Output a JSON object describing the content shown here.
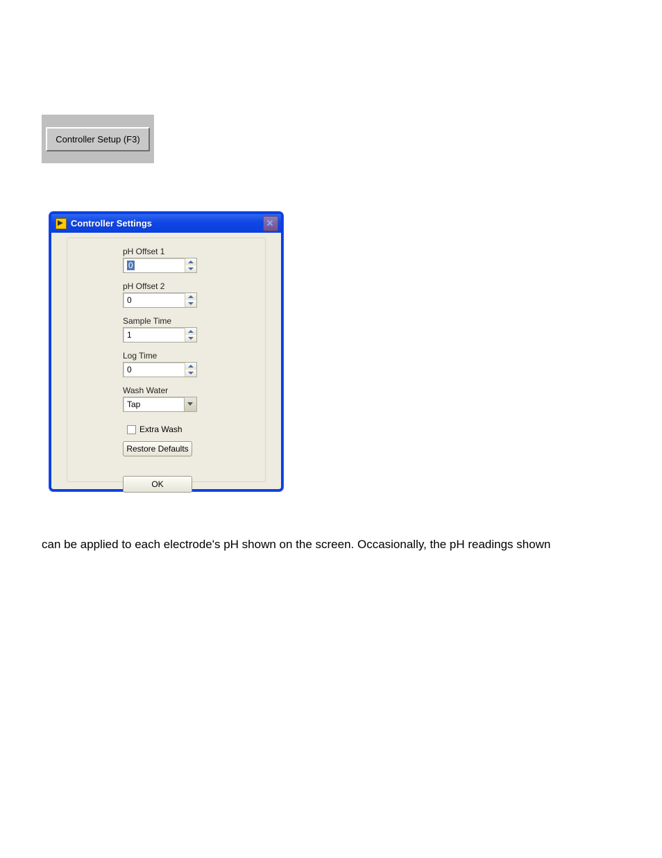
{
  "setup_button": {
    "label": "Controller Setup (F3)"
  },
  "dialog": {
    "title": "Controller Settings",
    "fields": {
      "ph_offset_1": {
        "label": "pH Offset 1",
        "value": "0"
      },
      "ph_offset_2": {
        "label": "pH Offset 2",
        "value": "0"
      },
      "sample_time": {
        "label": "Sample Time",
        "value": "1"
      },
      "log_time": {
        "label": "Log Time",
        "value": "0"
      },
      "wash_water": {
        "label": "Wash Water",
        "value": "Tap"
      }
    },
    "extra_wash": {
      "label": "Extra Wash",
      "checked": false
    },
    "restore_defaults": "Restore Defaults",
    "ok": "OK"
  },
  "paragraph": "can be applied to each electrode's pH shown on the screen.  Occasionally, the pH readings shown"
}
